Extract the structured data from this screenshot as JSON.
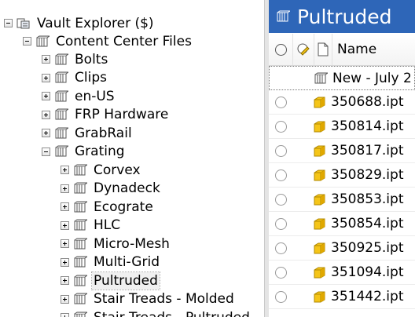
{
  "tree": {
    "root": {
      "label": "Vault Explorer ($)",
      "icon": "vault-explorer-icon"
    },
    "content_center": {
      "label": "Content Center Files",
      "icon": "library-icon"
    },
    "children": [
      {
        "label": "Bolts",
        "expanded": false
      },
      {
        "label": "Clips",
        "expanded": false
      },
      {
        "label": "en-US",
        "expanded": false
      },
      {
        "label": "FRP Hardware",
        "expanded": false
      },
      {
        "label": "GrabRail",
        "expanded": false
      },
      {
        "label": "Grating",
        "expanded": true
      }
    ],
    "grating_children": [
      {
        "label": "Corvex"
      },
      {
        "label": "Dynadeck"
      },
      {
        "label": "Ecograte"
      },
      {
        "label": "HLC"
      },
      {
        "label": "Micro-Mesh"
      },
      {
        "label": "Multi-Grid"
      },
      {
        "label": "Pultruded",
        "selected": true
      },
      {
        "label": "Stair Treads - Molded"
      },
      {
        "label": "Stair Treads - Pultruded"
      }
    ]
  },
  "panel": {
    "title": "Pultruded",
    "columns": {
      "name": "Name"
    },
    "rows": [
      {
        "name": "New - July 2",
        "icon": "library-icon"
      },
      {
        "name": "350688.ipt",
        "icon": "part-icon"
      },
      {
        "name": "350814.ipt",
        "icon": "part-icon"
      },
      {
        "name": "350817.ipt",
        "icon": "part-icon"
      },
      {
        "name": "350829.ipt",
        "icon": "part-icon"
      },
      {
        "name": "350853.ipt",
        "icon": "part-icon"
      },
      {
        "name": "350854.ipt",
        "icon": "part-icon"
      },
      {
        "name": "350925.ipt",
        "icon": "part-icon"
      },
      {
        "name": "351094.ipt",
        "icon": "part-icon"
      },
      {
        "name": "351442.ipt",
        "icon": "part-icon"
      }
    ]
  },
  "colors": {
    "titlebar": "#2e66b8",
    "part_icon": "#f5c518",
    "library_icon": "#555555"
  }
}
